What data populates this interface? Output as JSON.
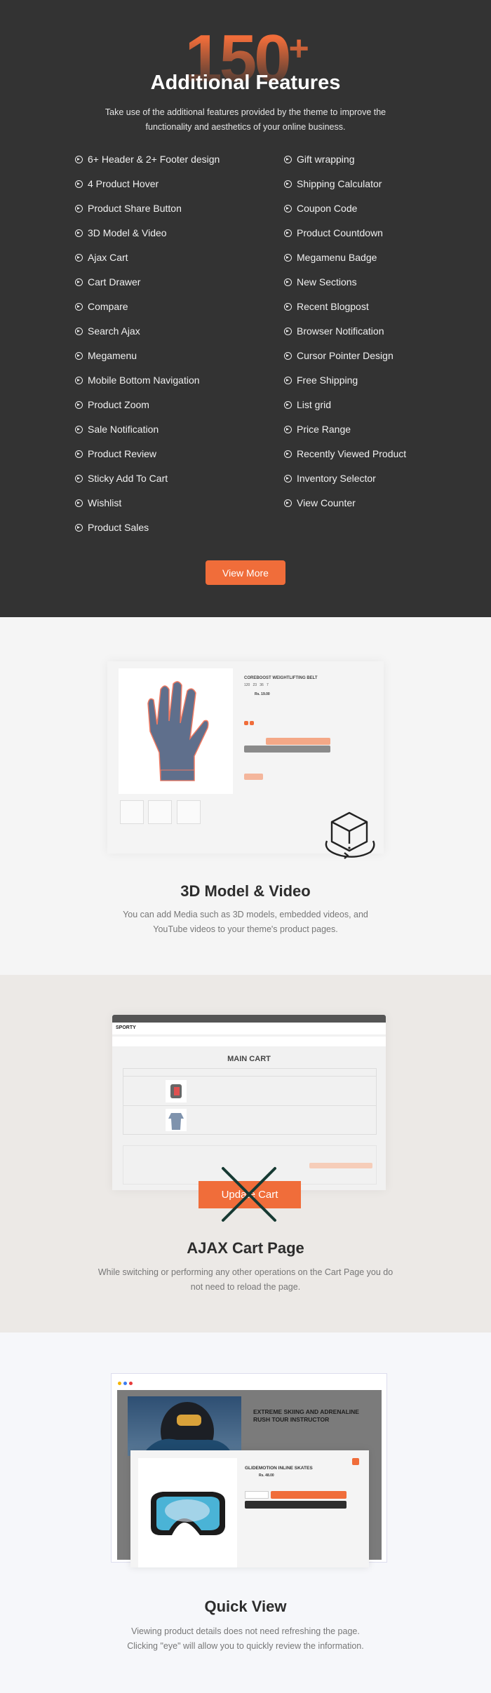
{
  "hero": {
    "number": "150",
    "plus": "+",
    "title": "Additional Features",
    "subtitle": "Take use of the additional features provided by the theme to improve the functionality and aesthetics of your online business.",
    "icon": "circle-arrow-right-icon",
    "features_left": [
      "6+ Header & 2+ Footer design",
      "4 Product Hover",
      "Product Share Button",
      "3D Model & Video",
      "Ajax Cart",
      "Cart Drawer",
      "Compare",
      "Search Ajax",
      "Megamenu",
      "Mobile Bottom Navigation",
      "Product Zoom",
      "Sale Notification",
      "Product Review",
      "Sticky Add To Cart",
      "Wishlist",
      "Product Sales"
    ],
    "features_right": [
      "Gift wrapping",
      "Shipping Calculator",
      "Coupon Code",
      "Product Countdown",
      "Megamenu Badge",
      "New Sections",
      "Recent Blogpost",
      "Browser Notification",
      "Cursor Pointer Design",
      "Free Shipping",
      "List grid",
      "Price Range",
      "Recently Viewed Product",
      "Inventory Selector",
      "View Counter"
    ],
    "view_more": "View More"
  },
  "model": {
    "title": "3D Model & Video",
    "desc": "You can add Media such as 3D models, embedded videos, and YouTube videos to your theme's product pages.",
    "product_title": "COREBOOST WEIGHTLIFTING BELT",
    "countdown": [
      "120",
      "23",
      "36",
      "7"
    ],
    "price": "Rs. 19.00",
    "icon": "3d-cube-rotate-icon"
  },
  "cart": {
    "title": "AJAX Cart Page",
    "desc": "While switching or performing any other operations on the Cart Page you do not need to reload the page.",
    "logo": "SPORTY",
    "main_cart": "MAIN CART",
    "update_label": "Update Cart"
  },
  "quick": {
    "title": "Quick View",
    "desc1": "Viewing product details does not need refreshing the page.",
    "desc2": "Clicking \"eye\" will allow you to quickly review the information.",
    "banner_title": "EXTREME SKIING AND ADRENALINE RUSH TOUR INSTRUCTOR",
    "product_title": "GLIDEMOTION INLINE SKATES",
    "price": "Rs. 48.00"
  },
  "colors": {
    "accent": "#f06d3a",
    "dark": "#333333"
  }
}
